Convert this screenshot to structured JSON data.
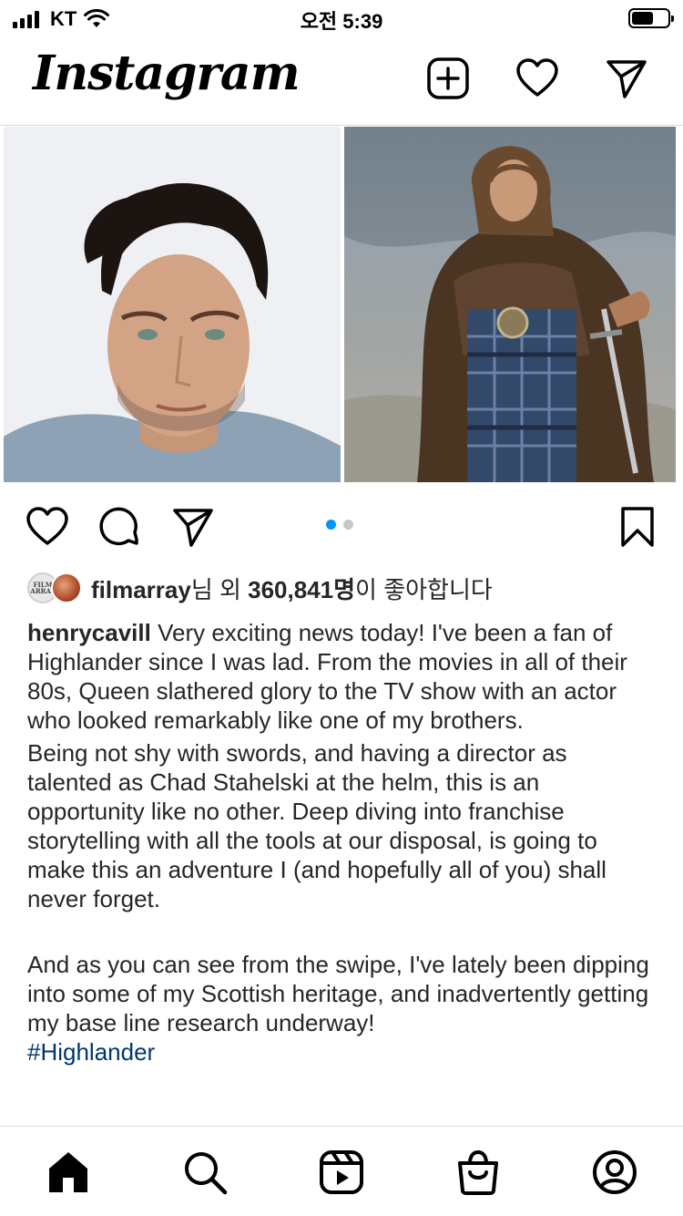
{
  "status_bar": {
    "carrier": "KT",
    "time": "오전 5:39"
  },
  "header": {
    "logo": "Instagram",
    "icons": [
      "plus-square-icon",
      "heart-icon",
      "send-icon"
    ]
  },
  "post": {
    "images": [
      "portrait-photo",
      "highlander-photo"
    ],
    "carousel": {
      "count": 2,
      "active": 1
    },
    "actions": [
      "like-icon",
      "comment-icon",
      "share-icon",
      "bookmark-icon"
    ],
    "likes": {
      "avatar_text": "FILM ARRAY",
      "username": "filmarray",
      "suffix_1": "님 외 ",
      "count": "360,841명",
      "suffix_2": "이 좋아합니다"
    },
    "caption": {
      "username": "henrycavill",
      "para1": "Very exciting news today! I've been a fan of Highlander since I was lad. From the movies in all of their 80s, Queen slathered glory to the TV show with an actor who looked remarkably like one of my brothers.",
      "para2": "Being not shy with swords, and having a director as talented as Chad Stahelski at the helm, this is an opportunity like no other. Deep diving into franchise storytelling with all the tools at our disposal, is going to make this an adventure I (and hopefully all of you) shall never forget.",
      "para3": "And as you can see from the swipe, I've lately been dipping into some of my Scottish heritage, and inadvertently getting my base line research underway!",
      "hashtag": "#Highlander"
    }
  },
  "bottom_nav": [
    "home-icon",
    "search-icon",
    "reels-icon",
    "shop-icon",
    "profile-icon"
  ],
  "colors": {
    "accent": "#0095f6",
    "hashtag": "#00376b",
    "text": "#262626",
    "divider": "#dbdbdb"
  }
}
